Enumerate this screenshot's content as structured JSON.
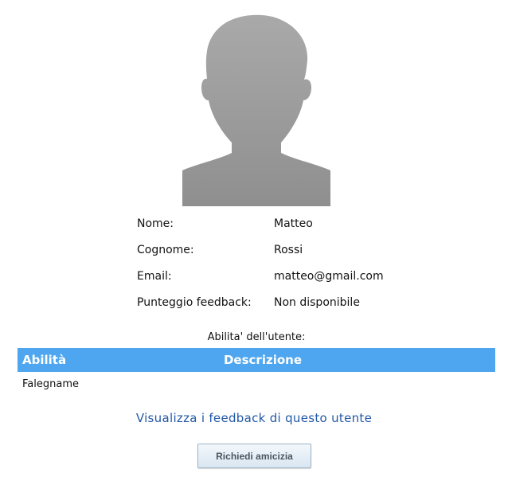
{
  "profile": {
    "avatar_icon": "person-silhouette-icon",
    "fields": [
      {
        "label": "Nome:",
        "value": "Matteo"
      },
      {
        "label": "Cognome:",
        "value": "Rossi"
      },
      {
        "label": "Email:",
        "value": "matteo@gmail.com"
      },
      {
        "label": "Punteggio feedback:",
        "value": "Non disponibile"
      }
    ]
  },
  "skills": {
    "caption": "Abilita' dell'utente:",
    "columns": [
      "Abilità",
      "Descrizione"
    ],
    "rows": [
      {
        "skill": "Falegname",
        "description": ""
      }
    ],
    "header_color": "#4da6ef"
  },
  "actions": {
    "feedback_link": "Visualizza i feedback di questo utente",
    "friend_button": "Richiedi amicizia",
    "link_color": "#2158a8"
  }
}
